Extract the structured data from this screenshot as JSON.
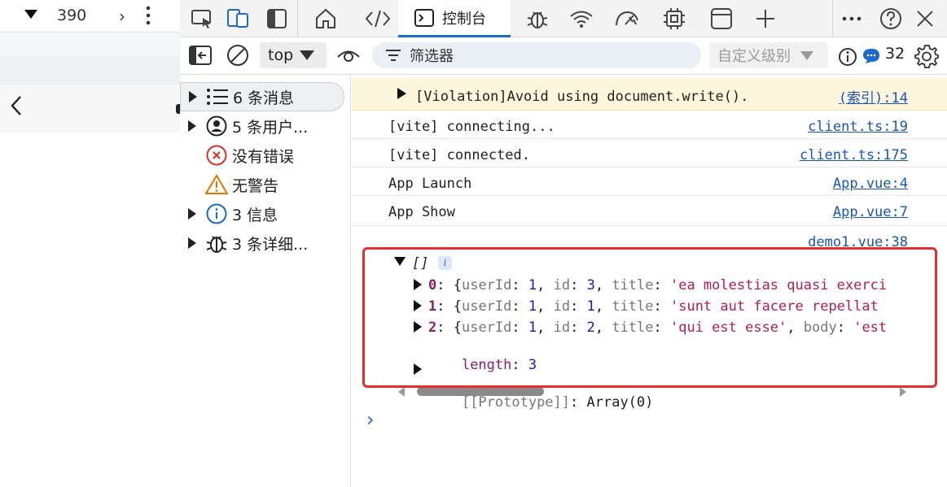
{
  "device": {
    "zoom_value": "390",
    "back_glyph": "‹"
  },
  "toolbar": {
    "tabs": [
      {
        "label": "控制台",
        "icon": "console-icon"
      }
    ],
    "icons": [
      "inspect-icon",
      "device-emulation-icon",
      "sidebar-toggle-icon",
      "home-icon",
      "sources-icon",
      "console-icon",
      "bug-icon",
      "network-icon",
      "performance-icon",
      "cpu-icon",
      "application-icon",
      "add-tab-icon",
      "more-icon",
      "help-icon",
      "close-icon"
    ]
  },
  "console_toolbar": {
    "context": "top",
    "filter_placeholder": "筛选器",
    "levels_label": "自定义级别",
    "message_count": "32"
  },
  "sidebar": {
    "items": [
      {
        "label": "6 条消息",
        "icon": "list-icon",
        "expandable": true,
        "selected": true
      },
      {
        "label": "5 条用户...",
        "icon": "user-icon",
        "expandable": true
      },
      {
        "label": "没有错误",
        "icon": "error-icon",
        "expandable": false
      },
      {
        "label": "无警告",
        "icon": "warning-icon",
        "expandable": false
      },
      {
        "label": "3 信息",
        "icon": "info-icon",
        "expandable": true
      },
      {
        "label": "3 条详细...",
        "icon": "bug-icon",
        "expandable": true
      }
    ]
  },
  "console": {
    "violation": {
      "text": "[Violation]Avoid using document.write().",
      "source": "(索引):14"
    },
    "messages": [
      {
        "text": "[vite] connecting...",
        "source": "client.ts:19"
      },
      {
        "text": "[vite] connected.",
        "source": "client.ts:175"
      },
      {
        "text": "App Launch",
        "source": "App.vue:4"
      },
      {
        "text": "App Show",
        "source": "App.vue:7"
      }
    ],
    "array_log": {
      "source": "demo1.vue:38",
      "summary": "[]",
      "items": [
        {
          "index": "0",
          "userId": "1",
          "id": "3",
          "title": "'ea molestias quasi exerci"
        },
        {
          "index": "1",
          "userId": "1",
          "id": "1",
          "title": "'sunt aut facere repellat"
        },
        {
          "index": "2",
          "userId": "1",
          "id": "2",
          "title": "'qui est esse'",
          "body_key": "body",
          "body": "'est"
        }
      ],
      "length_key": "length",
      "length_value": "3",
      "prototype": "[[Prototype]]",
      "prototype_value": "Array(0)"
    },
    "prompt": "›"
  },
  "colors": {
    "accent": "#1b6ac9",
    "highlight_border": "#e62e2e",
    "violation_bg": "#fdf6dc"
  }
}
